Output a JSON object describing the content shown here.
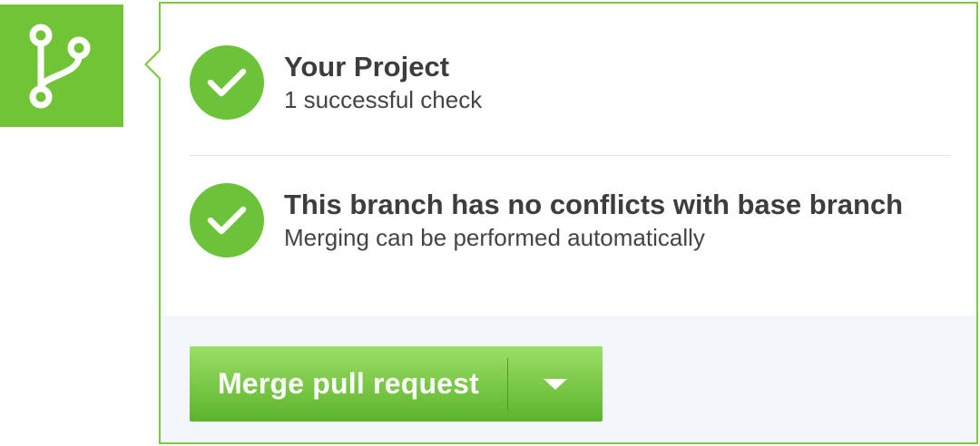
{
  "colors": {
    "accent": "#71c436",
    "border": "#7ac943",
    "check": "#6cc33a",
    "footer_bg": "#f3f6fa"
  },
  "icons": {
    "branch": "git-branch-icon",
    "check": "checkmark-icon",
    "dropdown": "caret-down-icon"
  },
  "checks": {
    "project_title": "Your Project",
    "project_sub": "1 successful check",
    "conflicts_title": "This branch has no conflicts with base branch",
    "conflicts_sub": "Merging can be performed automatically"
  },
  "merge": {
    "button_label": "Merge pull request"
  }
}
